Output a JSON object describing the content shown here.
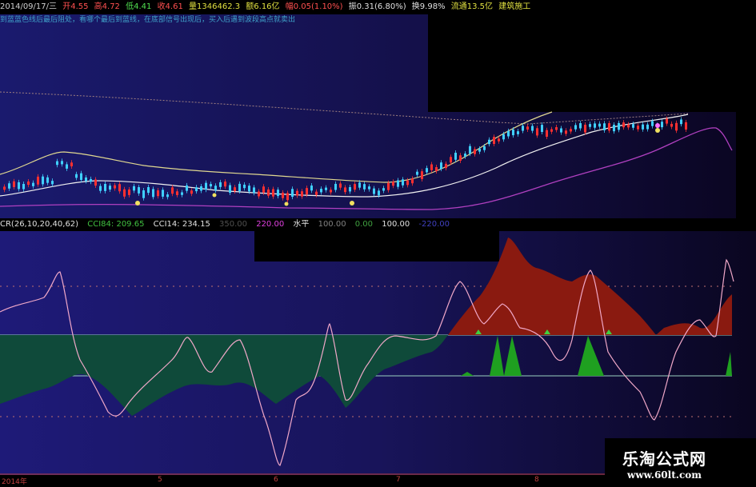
{
  "info_bar": {
    "date": "2014/09/17/三",
    "open": "开4.55",
    "high": "高4.72",
    "low": "低4.41",
    "close": "收4.61",
    "volume": "量1346462.3",
    "amount": "额6.16亿",
    "change": "幅0.05(1.10%)",
    "amplitude": "振0.31(6.80%)",
    "turnover": "换9.98%",
    "float_cap": "流通13.5亿",
    "sector": "建筑施工"
  },
  "ticker_text": "到蓝蓝色线后最后阻处，看哪个最后到蓝线，在底部信号出现后，买入后遇到波段高点就卖出",
  "indicator_bar": {
    "cr_label": "CR(26,10,20,40,62)",
    "cci84": "CCI84: 209.65",
    "cci14": "CCI14: 234.15",
    "level_350": "350.00",
    "level_220": "220.00",
    "water_label": "水平",
    "level_100a": "100.00",
    "level_0": "0.00",
    "level_100b": "100.00",
    "level_neg": "-220.00"
  },
  "x_axis": {
    "start": "2014年",
    "m5": "5",
    "m6": "6",
    "m7": "7",
    "m8": "8"
  },
  "watermark": {
    "title": "乐淘公式网",
    "url": "www.60lt.com"
  },
  "colors": {
    "up": "#ff3030",
    "down": "#40d0ff",
    "red_fill": "#8a1a10",
    "green_fill": "#0f4a3a",
    "spike": "#1fa020",
    "pink_line": "#f0a8c8",
    "purple_line": "#b040c0",
    "yellow_line": "#e0d890",
    "white_line": "#f0f0f0"
  }
}
